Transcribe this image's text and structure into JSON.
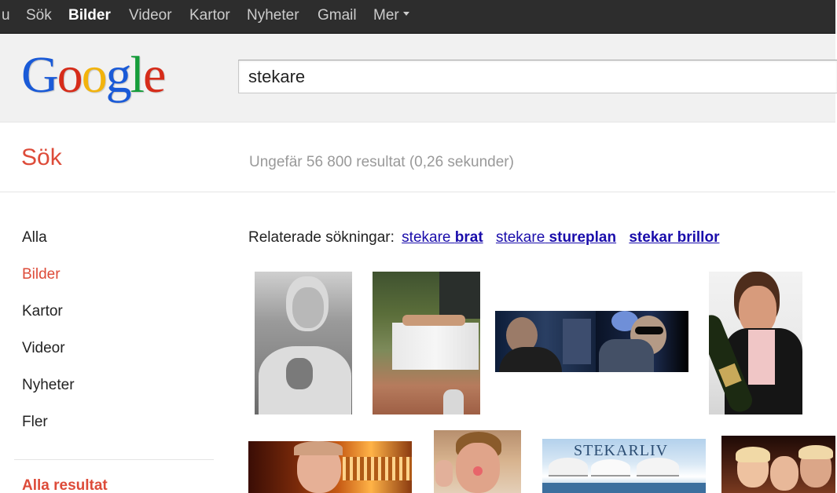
{
  "topbar": {
    "items": [
      {
        "label": "u",
        "active": false
      },
      {
        "label": "Sök",
        "active": false
      },
      {
        "label": "Bilder",
        "active": true
      },
      {
        "label": "Videor",
        "active": false
      },
      {
        "label": "Kartor",
        "active": false
      },
      {
        "label": "Nyheter",
        "active": false
      },
      {
        "label": "Gmail",
        "active": false
      },
      {
        "label": "Mer",
        "active": false
      }
    ]
  },
  "logo": {
    "letters": [
      "G",
      "o",
      "o",
      "g",
      "l",
      "e"
    ],
    "colors": [
      "#1a5ad7",
      "#d62c1a",
      "#f2b30c",
      "#1a5ad7",
      "#159d3a",
      "#d62c1a"
    ]
  },
  "search": {
    "value": "stekare"
  },
  "subheader": {
    "title": "Sök",
    "stats": "Ungefär 56 800 resultat (0,26 sekunder)"
  },
  "nav": {
    "items": [
      {
        "label": "Alla",
        "active": false
      },
      {
        "label": "Bilder",
        "active": true
      },
      {
        "label": "Kartor",
        "active": false
      },
      {
        "label": "Videor",
        "active": false
      },
      {
        "label": "Nyheter",
        "active": false
      },
      {
        "label": "Fler",
        "active": false
      }
    ],
    "all_results": "Alla resultat"
  },
  "related": {
    "label": "Relaterade sökningar:",
    "links": [
      {
        "plain": "stekare",
        "bold": "brat"
      },
      {
        "plain": "stekare",
        "bold": "stureplan"
      },
      {
        "plain": "",
        "bold": "stekar brillor"
      }
    ]
  },
  "images": {
    "caption_stekarliv": "STEKARLIV"
  },
  "colors": {
    "topbar_bg": "#2d2d2d",
    "accent_red": "#dd4b39",
    "link_blue": "#1a0dab",
    "stats_grey": "#999999"
  }
}
